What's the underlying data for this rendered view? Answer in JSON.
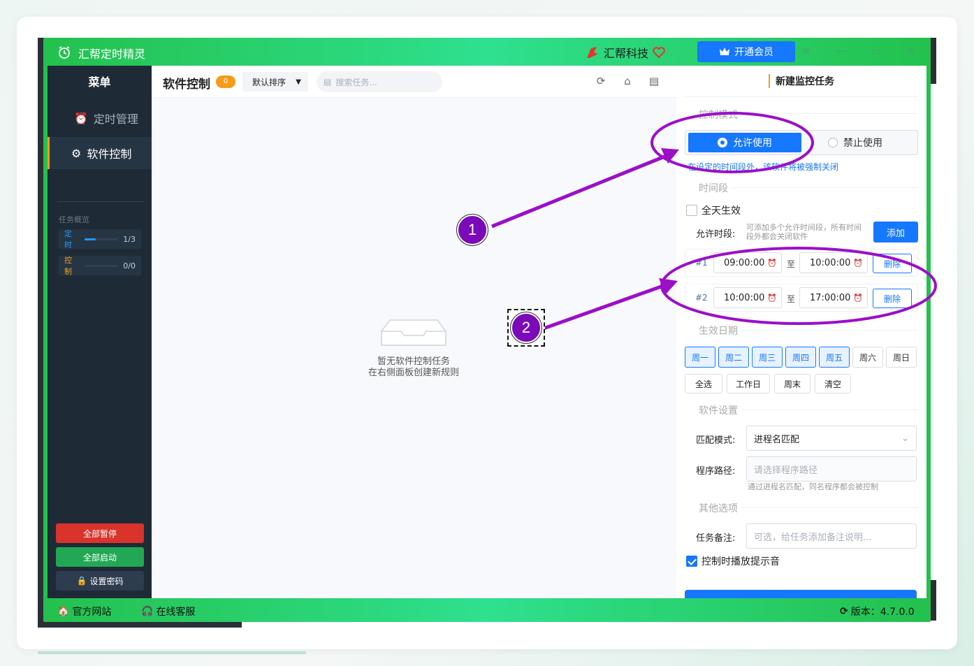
{
  "app": {
    "title": "汇帮定时精灵",
    "brand": "汇帮科技",
    "vip_button": "开通会员"
  },
  "sidebar": {
    "menu_title": "菜单",
    "items": [
      {
        "label": "定时管理",
        "icon": "alarm-clock-icon",
        "active": false
      },
      {
        "label": "软件控制",
        "icon": "gear-icon",
        "active": true
      }
    ],
    "overview_label": "任务概览",
    "overview": [
      {
        "label": "定时",
        "count": "1/3",
        "progress": 0.33,
        "color": "#1e9bff"
      },
      {
        "label": "控制",
        "count": "0/0",
        "progress": 0,
        "color": "#f59c1a"
      }
    ],
    "buttons": {
      "pause_all": "全部暂停",
      "start_all": "全部启动",
      "set_password": "设置密码"
    }
  },
  "main": {
    "title": "软件控制",
    "count": "0",
    "sort": "默认排序",
    "search_placeholder": "搜索任务...",
    "empty_line1": "暂无软件控制任务",
    "empty_line2": "在右侧面板创建新规则"
  },
  "panel": {
    "title": "新建监控任务",
    "mode_section": "控制模式",
    "mode_allow": "允许使用",
    "mode_deny": "禁止使用",
    "mode_hint": "在设定的时间段外，该软件将被强制关闭",
    "time_section": "时间段",
    "all_day": "全天生效",
    "allowed_label": "允许时段:",
    "allowed_hint": "可添加多个允许时间段，所有时间段外都会关闭软件",
    "add_button": "添加",
    "slots": [
      {
        "index": "#1",
        "start": "09:00:00",
        "end": "10:00:00"
      },
      {
        "index": "#2",
        "start": "10:00:00",
        "end": "17:00:00"
      }
    ],
    "to": "至",
    "delete": "删除",
    "date_section": "生效日期",
    "days": [
      {
        "label": "周一",
        "on": true
      },
      {
        "label": "周二",
        "on": true
      },
      {
        "label": "周三",
        "on": true
      },
      {
        "label": "周四",
        "on": true
      },
      {
        "label": "周五",
        "on": true
      },
      {
        "label": "周六",
        "on": false
      },
      {
        "label": "周日",
        "on": false
      }
    ],
    "quick": [
      "全选",
      "工作日",
      "周末",
      "清空"
    ],
    "software_section": "软件设置",
    "match_label": "匹配模式:",
    "match_value": "进程名匹配",
    "path_label": "程序路径:",
    "path_placeholder": "请选择程序路径",
    "path_hint": "通过进程名匹配，同名程序都会被控制",
    "other_section": "其他选项",
    "note_label": "任务备注:",
    "note_placeholder": "可选，给任务添加备注说明...",
    "sound": "控制时播放提示音"
  },
  "statusbar": {
    "website": "官方网站",
    "support": "在线客服",
    "version": "版本：4.7.0.0"
  },
  "annotations": {
    "one": "1",
    "two": "2",
    "color": "#9b0fc9"
  }
}
